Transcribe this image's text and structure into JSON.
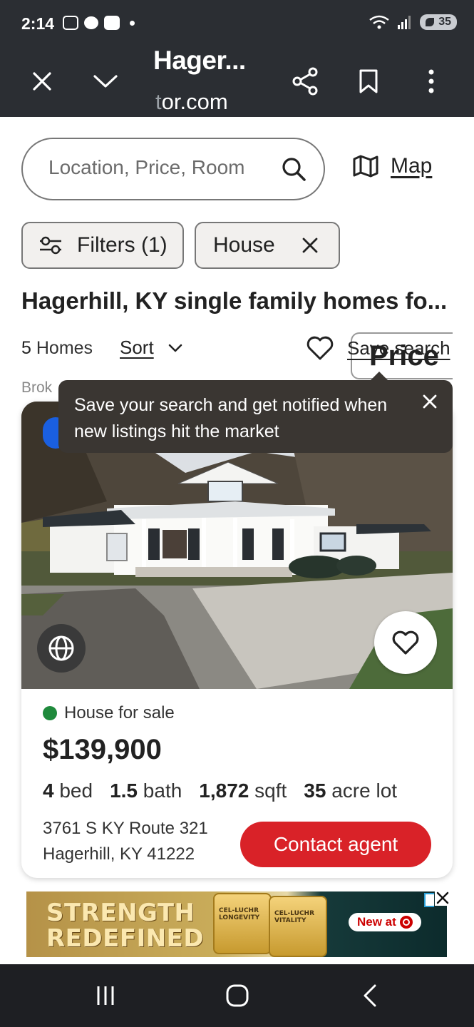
{
  "status_bar": {
    "time": "2:14",
    "battery": "35",
    "signal_label": "5"
  },
  "browser": {
    "title": "Hager...",
    "domain_prefix": "t",
    "domain_rest": "or.com"
  },
  "search": {
    "placeholder": "Location, Price, Room",
    "map_label": "Map"
  },
  "chips": {
    "filters": "Filters (1)",
    "house": "House",
    "price": "Price"
  },
  "results": {
    "title": "Hagerhill, KY single family homes fo...",
    "count_number": "5",
    "count_label": "Homes",
    "sort_label": "Sort",
    "save_search_label": "Save search",
    "broker_text": "Brok"
  },
  "tooltip": {
    "text": "Save your search and get notified when new listings hit the market"
  },
  "listing": {
    "status": "House for sale",
    "price": "$139,900",
    "beds_value": "4",
    "beds_unit": "bed",
    "baths_value": "1.5",
    "baths_unit": "bath",
    "sqft_value": "1,872",
    "sqft_unit": "sqft",
    "lot_value": "35",
    "lot_unit": "acre lot",
    "address_line1": "3761 S KY Route 321",
    "address_line2": "Hagerhill, KY 41222",
    "contact_label": "Contact agent"
  },
  "ad": {
    "headline_line1": "STRENGTH",
    "headline_line2": "REDEFINED",
    "product1_label": "CEL-LUCHR LONGEVITY",
    "product2_label": "CEL-LUCHR VITALITY",
    "cta": "New at"
  },
  "colors": {
    "accent": "#d92228",
    "topbar": "#2b2e33",
    "tooltip": "#3a3632",
    "status_green": "#1f8a3c"
  }
}
